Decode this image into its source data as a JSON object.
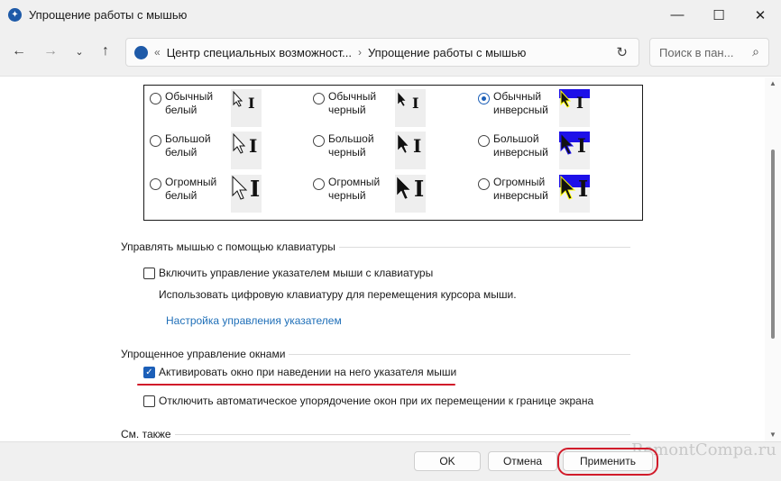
{
  "window": {
    "title": "Упрощение работы с мышью",
    "minimize_icon": "minimize-icon",
    "maximize_icon": "maximize-icon",
    "close_icon": "close-icon"
  },
  "nav": {
    "breadcrumb": "Центр специальных возможност...",
    "current": "Упрощение работы с мышью",
    "search_placeholder": "Поиск в пан..."
  },
  "schemes": [
    {
      "label": "Обычный белый",
      "checked": false
    },
    {
      "label": "Обычный черный",
      "checked": false
    },
    {
      "label": "Обычный инверсный",
      "checked": true
    },
    {
      "label": "Большой белый",
      "checked": false
    },
    {
      "label": "Большой черный",
      "checked": false
    },
    {
      "label": "Большой инверсный",
      "checked": false
    },
    {
      "label": "Огромный белый",
      "checked": false
    },
    {
      "label": "Огромный черный",
      "checked": false
    },
    {
      "label": "Огромный инверсный",
      "checked": false
    }
  ],
  "keyboard_section": {
    "title": "Управлять мышью с помощью клавиатуры",
    "checkbox_label": "Включить управление указателем мыши с клавиатуры",
    "checkbox_checked": false,
    "description": "Использовать цифровую клавиатуру для перемещения курсора мыши.",
    "link": "Настройка управления указателем"
  },
  "windows_section": {
    "title": "Упрощенное управление окнами",
    "activate_label": "Активировать окно при наведении на него указателя мыши",
    "activate_checked": true,
    "snap_label": "Отключить автоматическое упорядочение окон при их перемещении к границе экрана",
    "snap_checked": false
  },
  "see_also": {
    "title": "См. также"
  },
  "footer": {
    "ok": "OK",
    "cancel": "Отмена",
    "apply": "Применить",
    "watermark": "RemontCompa.ru"
  },
  "colors": {
    "accent": "#1c5fb8",
    "highlight_red": "#d11b2a",
    "inverse_blue": "#1d10e8",
    "link": "#1f6fb8"
  }
}
